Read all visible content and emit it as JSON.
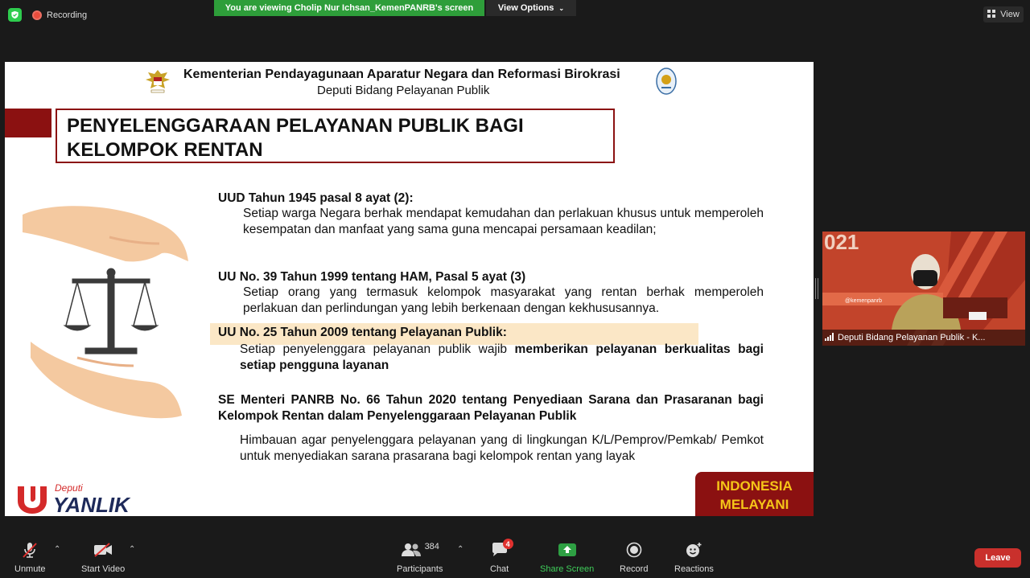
{
  "top_bar": {
    "recording_label": "Recording",
    "viewing_banner": "You are viewing Cholip Nur Ichsan_KemenPANRB's screen",
    "view_options_label": "View Options",
    "view_label": "View"
  },
  "slide": {
    "header_line1": "Kementerian Pendayagunaan Aparatur Negara dan Reformasi Birokrasi",
    "header_line2": "Deputi Bidang Pelayanan Publik",
    "title_line1": "PENYELENGGARAAN PELAYANAN PUBLIK BAGI",
    "title_line2": "KELOMPOK RENTAN",
    "sections": [
      {
        "heading": "UUD Tahun 1945 pasal 8 ayat (2):",
        "body": "Setiap warga Negara berhak mendapat kemudahan dan perlakuan khusus untuk memperoleh kesempatan dan manfaat yang sama guna mencapai persamaan keadilan;"
      },
      {
        "heading": "UU No. 39 Tahun 1999 tentang HAM, Pasal 5 ayat (3)",
        "body": "Setiap orang yang termasuk kelompok masyarakat yang rentan berhak memperoleh perlakuan dan perlindungan  yang lebih berkenaan dengan kekhususannya."
      },
      {
        "heading": "UU No. 25 Tahun 2009 tentang Pelayanan Publik:",
        "body_prefix": "Setiap penyelenggara pelayanan publik wajib ",
        "body_bold": "memberikan pelayanan berkualitas bagi setiap pengguna layanan"
      },
      {
        "heading": "SE Menteri PANRB No. 66 Tahun 2020 tentang Penyediaan Sarana dan Prasaranan bagi Kelompok Rentan dalam Penyelenggaraan Pelayanan Publik",
        "body": "Himbauan agar penyelenggara pelayanan yang di lingkungan K/L/Pemprov/Pemkab/ Pemkot untuk menyediakan sarana prasarana bagi kelompok rentan yang layak"
      }
    ],
    "logo_deputi": "Deputi",
    "logo_yanlik": "YANLIK",
    "badge_line1": "INDONESIA",
    "badge_line2": "MELAYANI"
  },
  "video_tile": {
    "participant_name": "Deputi Bidang Pelayanan Publik - K...",
    "bg_text": "021",
    "handle_text": "@kemenpanrb"
  },
  "toolbar": {
    "unmute": "Unmute",
    "start_video": "Start Video",
    "participants": "Participants",
    "participants_count": "384",
    "chat": "Chat",
    "chat_badge": "4",
    "share_screen": "Share Screen",
    "record": "Record",
    "reactions": "Reactions",
    "leave": "Leave"
  },
  "colors": {
    "accent_green": "#2e9e3a",
    "brand_red": "#8b1111",
    "leave_red": "#c9302c",
    "badge_yellow": "#f5c518"
  }
}
